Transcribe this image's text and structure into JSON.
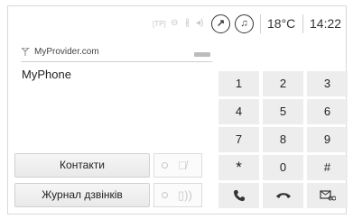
{
  "status_bar": {
    "icons": [
      "tp-icon",
      "settings-icon",
      "bluetooth-icon",
      "volume-icon",
      "navigation-icon",
      "music-icon"
    ],
    "temperature": "18°C",
    "time": "14:22"
  },
  "provider": {
    "name": "MyProvider.com"
  },
  "phone": {
    "name": "MyPhone"
  },
  "keypad": {
    "keys": [
      "1",
      "2",
      "3",
      "4",
      "5",
      "6",
      "7",
      "8",
      "9",
      "*",
      "0",
      "#"
    ]
  },
  "buttons": {
    "contacts": "Контакти",
    "call_log": "Журнал дзвінків"
  }
}
